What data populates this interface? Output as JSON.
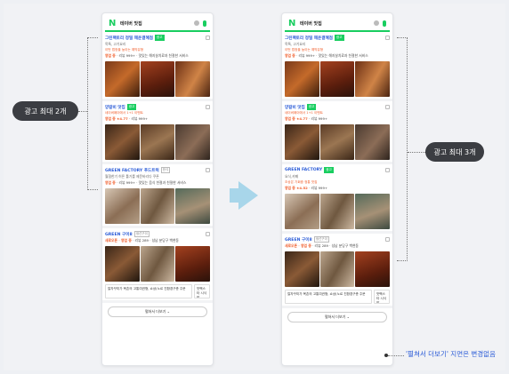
{
  "colors": {
    "naver_green": "#19ce60",
    "link_blue": "#2a5bd7",
    "promo_orange": "#f05b28",
    "pill_dark": "#3b3d42",
    "arrow": "#a8d6ea"
  },
  "search": {
    "logo": "N",
    "query": "테이버 맛집"
  },
  "left_phone": {
    "listings": [
      {
        "name": "그린팩토리 정밀 해운결혜점",
        "badge": "광고",
        "category": "목톡, 고기요리",
        "promo": "이번 법정을 높이는 예약유형",
        "meta_prefix": "영업 중",
        "meta": "· 리뷰 999+ · 맛있는 해지살치료과 친절한 서비스"
      },
      {
        "name": "양갈비 맛집",
        "badge": "광고",
        "category": "",
        "promo": "네이버페이에서 1+1 이벤트",
        "meta_prefix": "영업 중",
        "rating": "★4.77",
        "meta": "· 리뷰 999+"
      },
      {
        "name": "GREEN FACTORY 푸드트럭",
        "badge": "한식",
        "category": "월협한기 허른 톨기를 제문바리다 쿠폰",
        "promo": "",
        "meta_prefix": "영업 중",
        "meta": "· 리뷰 999+ · 맛있는 음식 친절과 친절한 서비스"
      },
      {
        "name": "GREEN 구이8",
        "badge": "생선구이",
        "category": "",
        "promo": "",
        "meta_prefix": "새로오픈 · 영업 중",
        "meta": "· 리뷰 289 · 성남 분당구 백현동"
      }
    ],
    "bottom_cards": [
      "칼자꾸미가 목촌의 고통여권형, 쇼상(노르 친환경구총 주문",
      "맛팩스타 시식방"
    ],
    "more_button": "펼쳐서 더보기 ⌄"
  },
  "right_phone": {
    "listings": [
      {
        "name": "그린팩토리 정밀 해운결혜점",
        "badge": "광고",
        "category": "목톡, 고기요리",
        "promo": "이번 법정을 높이는 예약유형",
        "meta_prefix": "영업 중",
        "meta": "· 리뷰 999+ · 맛있는 해지살치료과 친절한 서비스"
      },
      {
        "name": "양갈비 맛집",
        "badge": "광고",
        "category": "",
        "promo": "네이버페이에서 1+1 이벤트",
        "meta_prefix": "영업 중",
        "rating": "★4.77",
        "meta": "· 리뷰 999+"
      },
      {
        "name": "GREEN FACTORY",
        "badge": "광고",
        "category": "요식,카페",
        "promo": "조상은 기회중 정통 맛집",
        "meta_prefix": "영업 중",
        "rating": "★4.52",
        "meta": "· 리뷰 999+"
      },
      {
        "name": "GREEN 구이8",
        "badge": "생선구이",
        "category": "",
        "promo": "",
        "meta_prefix": "새로오픈 · 영업 중",
        "meta": "· 리뷰 289 · 성남 분당구 백현동"
      }
    ],
    "bottom_cards": [
      "칼자꾸미가 목촌의 고통여권형, 쇼상(노르 친환경구총 주문",
      "맛팩스타 시식방"
    ],
    "more_button": "펼쳐서 더보기 ⌄"
  },
  "annotations": {
    "left_label": "광고 최대 2개",
    "right_label": "광고 최대 3개",
    "note": "'펼쳐서 더보기' 지면은 변경없음"
  }
}
